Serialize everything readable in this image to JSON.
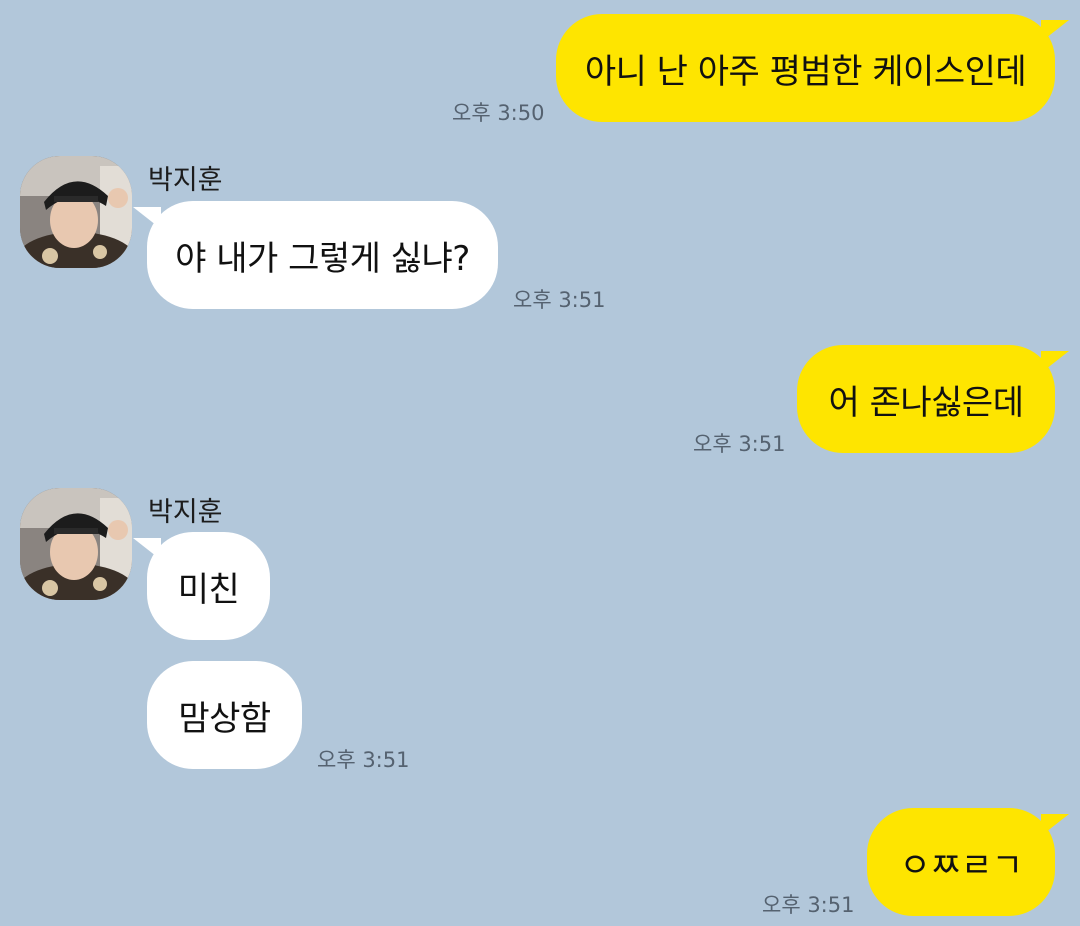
{
  "contact": {
    "name": "박지훈"
  },
  "colors": {
    "background": "#b2c7da",
    "my_bubble": "#fee500",
    "their_bubble": "#ffffff",
    "timestamp": "#556270"
  },
  "messages": [
    {
      "from": "me",
      "text": "아니 난 아주 평범한 케이스인데",
      "time": "오후 3:50"
    },
    {
      "from": "contact",
      "text": "야 내가 그렇게 싫냐?",
      "time": "오후 3:51"
    },
    {
      "from": "me",
      "text": "어 존나싫은데",
      "time": "오후 3:51"
    },
    {
      "from": "contact",
      "text": "미친",
      "time": ""
    },
    {
      "from": "contact",
      "text": "맘상함",
      "time": "오후 3:51"
    },
    {
      "from": "me",
      "text": "ㅇㅉㄹㄱ",
      "time": "오후 3:51"
    }
  ]
}
